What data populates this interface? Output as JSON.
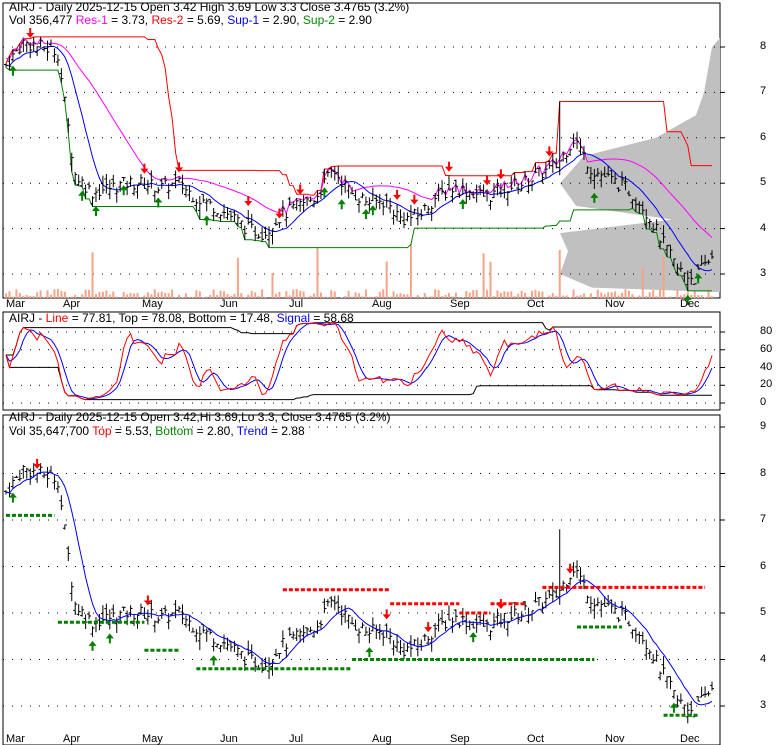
{
  "panel1": {
    "title": "AIRJ - Daily 2025-12-15 Open 3.42  High 3.69  Low 3.3  Close 3.4765 (3.2%)",
    "vol": "Vol 356,477",
    "res1_label": "Res-1",
    "res1_value": " = 3.73, ",
    "res2_label": "Res-2",
    "res2_value": " = 5.69, ",
    "sup1_label": "Sup-1",
    "sup1_value": " = 2.90, ",
    "sup2_label": "Sup-2",
    "sup2_value": " = 2.90"
  },
  "panel2": {
    "prefix": "AIRJ - ",
    "line_label": "Line",
    "line_value": " = 77.81, Top = 78.08, Bottom = 17.48, ",
    "signal_label": "Signal",
    "signal_value": " = 58.68"
  },
  "panel3": {
    "title": "AIRJ - Daily 2025-12-15 Open 3.42,Hi 3.69,Lo 3.3, Close 3.4765 (3.2%)",
    "vol": "Vol 35,647,700 ",
    "top_label": "Top",
    "top_value": " = 5.53, ",
    "bottom_label": "Bottom",
    "bottom_value": " = 2.80, ",
    "trend_label": "Trend",
    "trend_value": " = 2.88"
  },
  "colors": {
    "red": "#ff0000",
    "green": "#008000",
    "blue": "#0000ff",
    "magenta": "#ff00ff",
    "volume": "#f4a488",
    "profile": "#c0c0c0"
  },
  "chart_data": [
    {
      "type": "candlestick",
      "title": "AIRJ Daily price with support/resistance",
      "y_ticks": [
        "3",
        "4",
        "5",
        "6",
        "7",
        "8"
      ],
      "ylim": [
        2.5,
        8.8
      ],
      "x_ticks": [
        "Mar",
        "Apr",
        "May",
        "Jun",
        "Jul",
        "Aug",
        "Sep",
        "Oct",
        "Nov",
        "Dec"
      ],
      "weekly_close": [
        7.6,
        8.1,
        8.0,
        7.9,
        5.2,
        4.8,
        4.9,
        5.0,
        5.0,
        4.9,
        5.0,
        4.7,
        4.5,
        4.3,
        4.0,
        3.9,
        4.3,
        4.5,
        4.7,
        5.3,
        4.8,
        4.6,
        4.6,
        4.2,
        4.3,
        4.7,
        4.9,
        4.8,
        4.7,
        4.9,
        5.0,
        5.2,
        5.4,
        6.0,
        5.3,
        5.1,
        4.9,
        4.5,
        3.8,
        3.1,
        2.9,
        3.4
      ],
      "res1": 3.73,
      "res2": 5.69,
      "sup1": 2.9,
      "sup2": 2.9
    },
    {
      "type": "line",
      "title": "Stochastic",
      "y_ticks": [
        "0",
        "20",
        "40",
        "60",
        "80"
      ],
      "ylim": [
        -5,
        90
      ],
      "line": 77.81,
      "top": 78.08,
      "bottom": 17.48,
      "signal": 58.68
    },
    {
      "type": "candlestick",
      "title": "AIRJ Daily trend",
      "y_ticks": [
        "3",
        "4",
        "5",
        "6",
        "7",
        "8",
        "9"
      ],
      "ylim": [
        2.6,
        9.0
      ],
      "top": 5.53,
      "bottom": 2.8,
      "trend": 2.88
    }
  ]
}
